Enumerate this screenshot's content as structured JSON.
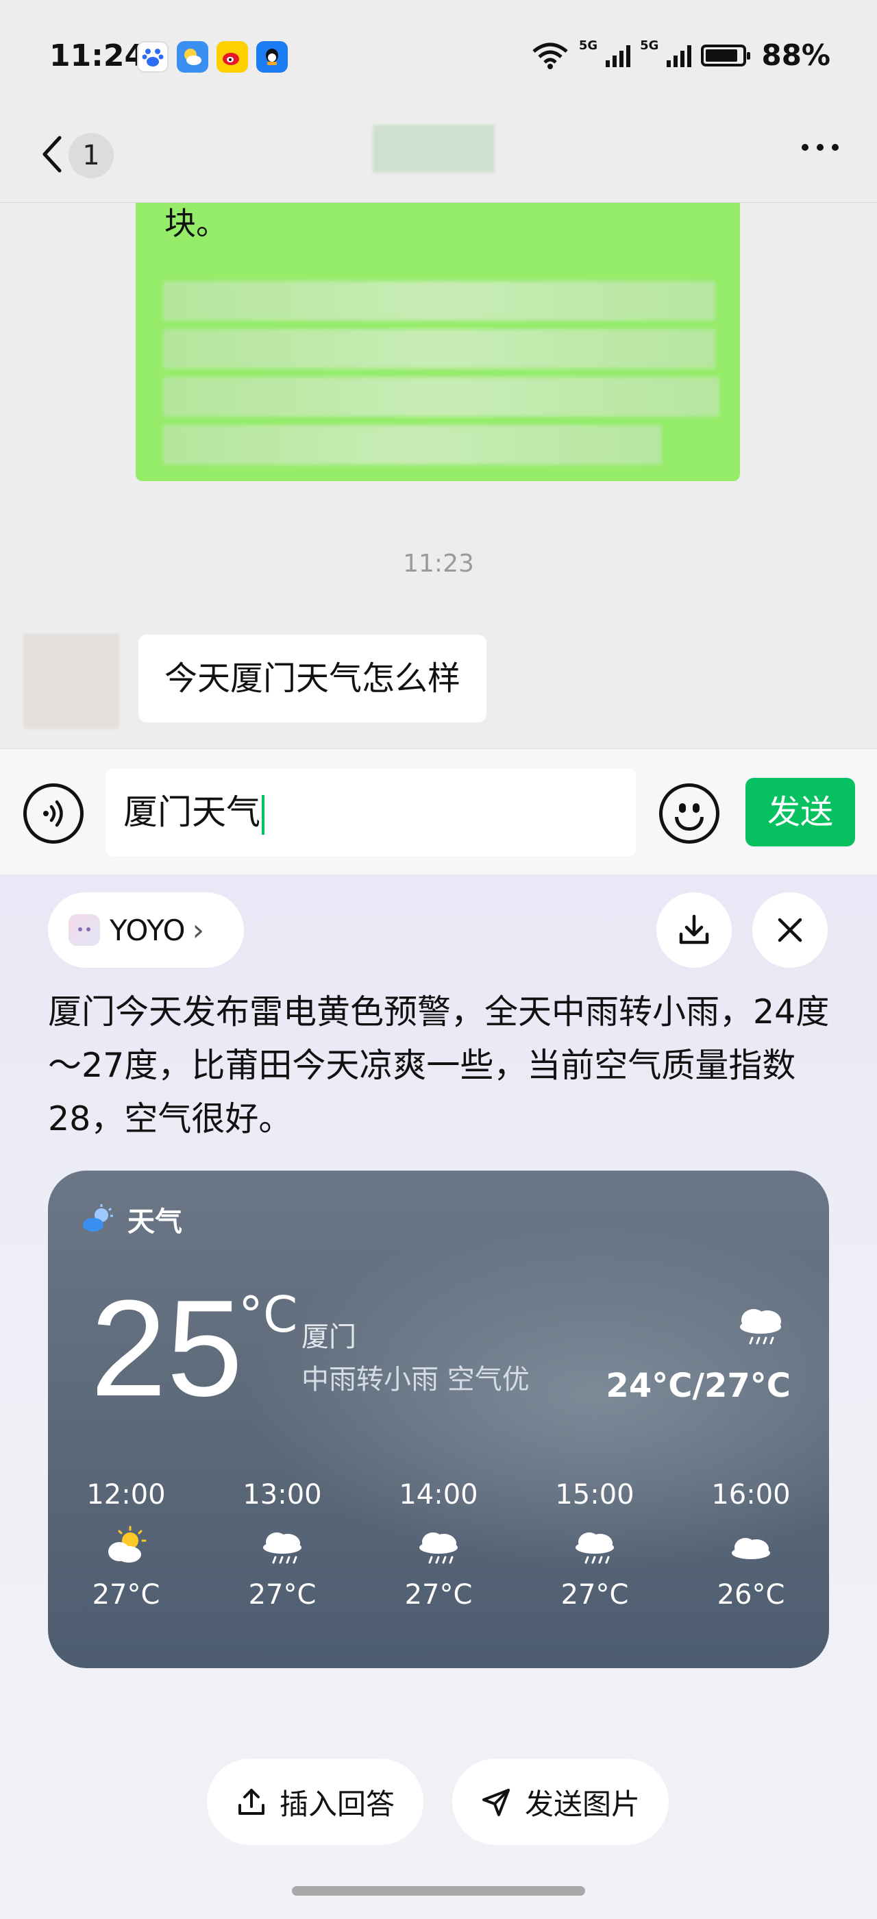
{
  "status_bar": {
    "time": "11:24",
    "signal_labels": [
      "5G",
      "5G"
    ],
    "wifi_label": "6",
    "battery": "88%",
    "battery_level": 0.88,
    "apps": [
      "baidu-icon",
      "weather-app-icon",
      "weibo-icon",
      "qq-icon"
    ]
  },
  "nav": {
    "unread_count": "1"
  },
  "chat": {
    "green_bubble_visible_text": "块。",
    "time_divider": "11:23",
    "incoming_message": "今天厦门天气怎么样"
  },
  "input": {
    "value": "厦门天气",
    "send_label": "发送"
  },
  "assistant": {
    "name": "YOYO",
    "answer": "厦门今天发布雷电黄色预警，全天中雨转小雨，24度～27度，比莆田今天凉爽一些，当前空气质量指数28，空气很好。",
    "weather_card": {
      "header": "天气",
      "temperature": "25",
      "unit": "°C",
      "city": "厦门",
      "condition": "中雨转小雨 空气优",
      "range": "24°C/27°C",
      "hourly": [
        {
          "time": "12:00",
          "icon": "partly-sunny-icon",
          "temp": "27°C"
        },
        {
          "time": "13:00",
          "icon": "rain-cloud-icon",
          "temp": "27°C"
        },
        {
          "time": "14:00",
          "icon": "rain-cloud-icon",
          "temp": "27°C"
        },
        {
          "time": "15:00",
          "icon": "rain-cloud-icon",
          "temp": "27°C"
        },
        {
          "time": "16:00",
          "icon": "cloud-icon",
          "temp": "26°C"
        }
      ]
    },
    "actions": {
      "insert_answer": "插入回答",
      "send_image": "发送图片"
    }
  },
  "colors": {
    "accent_green": "#07c160",
    "bubble_green": "#95ec69",
    "card_bg": "#5b6878"
  }
}
